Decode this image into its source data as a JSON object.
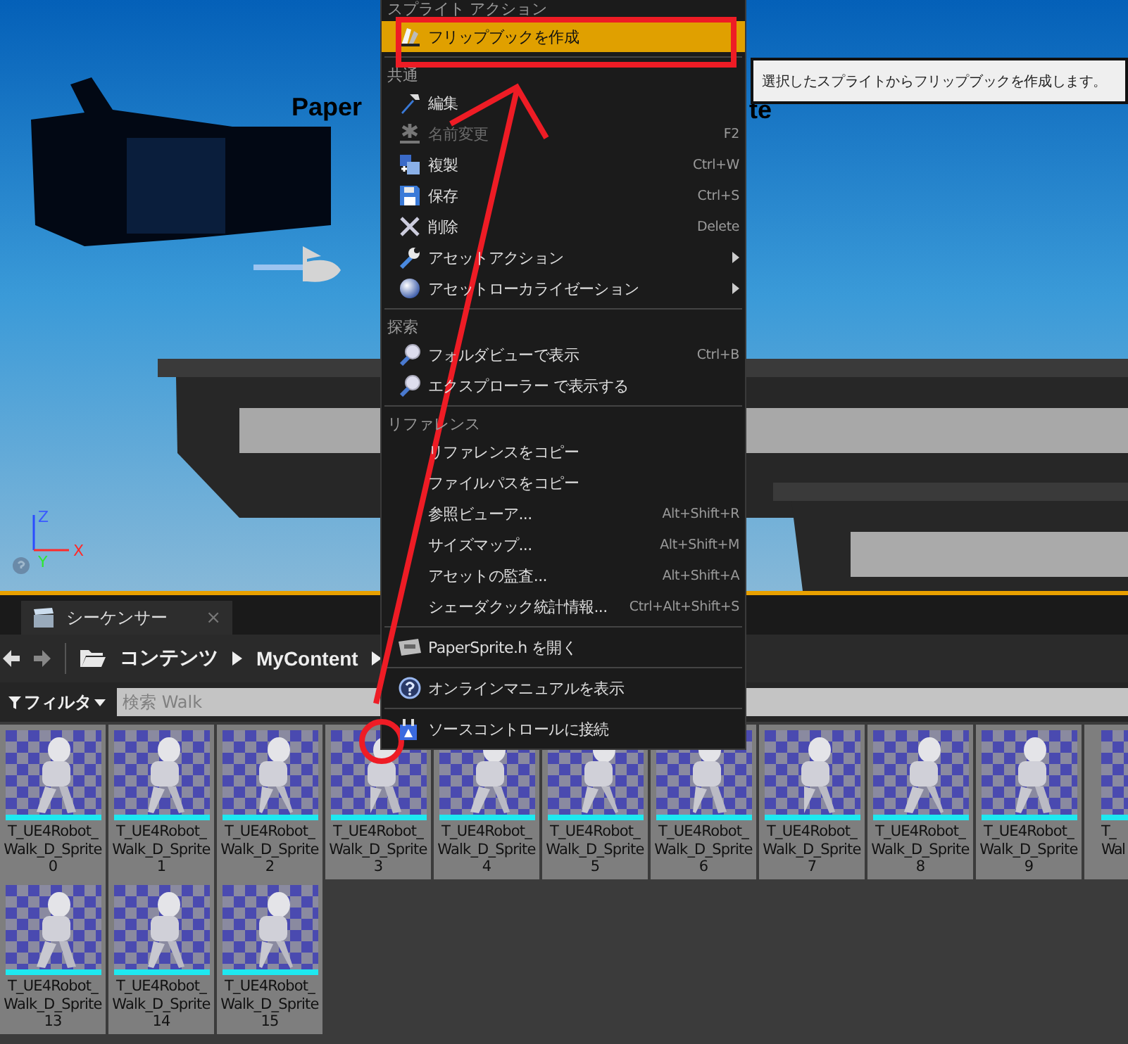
{
  "viewport": {
    "kind": "picture",
    "scene_text": [
      "Paper",
      "te"
    ],
    "axes": [
      "Z",
      "Y",
      "X"
    ]
  },
  "tabs": [
    {
      "label": "シーケンサー",
      "selected": true,
      "close": "×"
    }
  ],
  "breadcrumb": [
    "コンテンツ",
    "MyContent"
  ],
  "filter": {
    "label": "フィルタ"
  },
  "search": {
    "placeholder": "検索 Walk"
  },
  "menu": {
    "sections": [
      {
        "heading": "スプライト アクション",
        "items": [
          {
            "label": "フリップブックを作成",
            "kind": "flipbook",
            "selected": true,
            "disabled": false,
            "submenu": false
          }
        ]
      },
      {
        "heading": "共通",
        "items": [
          {
            "label": "編集",
            "kind": "hammer",
            "selected": false,
            "disabled": false,
            "submenu": false
          },
          {
            "label": "名前変更",
            "shortcut": "F2",
            "kind": "star",
            "selected": false,
            "disabled": true,
            "submenu": false
          },
          {
            "label": "複製",
            "shortcut": "Ctrl+W",
            "kind": "duplicate",
            "selected": false,
            "disabled": false,
            "submenu": false
          },
          {
            "label": "保存",
            "shortcut": "Ctrl+S",
            "kind": "floppy",
            "selected": false,
            "disabled": false,
            "submenu": false
          },
          {
            "label": "削除",
            "shortcut": "Delete",
            "kind": "cross",
            "selected": false,
            "disabled": false,
            "submenu": false
          },
          {
            "label": "アセットアクション",
            "kind": "wrench",
            "selected": false,
            "disabled": false,
            "submenu": true
          },
          {
            "label": "アセットローカライゼーション",
            "kind": "sphere",
            "selected": false,
            "disabled": false,
            "submenu": true
          }
        ]
      },
      {
        "heading": "探索",
        "items": [
          {
            "label": "フォルダビューで表示",
            "shortcut": "Ctrl+B",
            "kind": "magnifier",
            "selected": false,
            "disabled": false,
            "submenu": false
          },
          {
            "label": "エクスプローラー で表示する",
            "kind": "magnifier",
            "selected": false,
            "disabled": false,
            "submenu": false
          }
        ]
      },
      {
        "heading": "リファレンス",
        "items": [
          {
            "label": "リファレンスをコピー",
            "kind": "plain",
            "selected": false,
            "disabled": false,
            "submenu": false
          },
          {
            "label": "ファイルパスをコピー",
            "kind": "plain",
            "selected": false,
            "disabled": false,
            "submenu": false
          },
          {
            "label": "参照ビューア...",
            "shortcut": "Alt+Shift+R",
            "kind": "plain",
            "selected": false,
            "disabled": false,
            "submenu": false
          },
          {
            "label": "サイズマップ...",
            "shortcut": "Alt+Shift+M",
            "kind": "plain",
            "selected": false,
            "disabled": false,
            "submenu": false
          },
          {
            "label": "アセットの監査...",
            "shortcut": "Alt+Shift+A",
            "kind": "plain",
            "selected": false,
            "disabled": false,
            "submenu": false
          },
          {
            "label": "シェーダクック統計情報...",
            "shortcut": "Ctrl+Alt+Shift+S",
            "kind": "plain",
            "selected": false,
            "disabled": false,
            "submenu": false
          }
        ]
      },
      {
        "items": [
          {
            "label": "PaperSprite.h を開く",
            "kind": "code",
            "selected": false,
            "disabled": false,
            "submenu": false
          }
        ]
      },
      {
        "items": [
          {
            "label": "オンラインマニュアルを表示",
            "kind": "help",
            "selected": false,
            "disabled": false,
            "submenu": false
          }
        ]
      },
      {
        "items": [
          {
            "label": "ソースコントロールに接続",
            "kind": "plug",
            "selected": false,
            "disabled": false,
            "submenu": false
          }
        ]
      }
    ]
  },
  "tooltip": "選択したスプライトからフリップブックを作成します。",
  "assets": {
    "rows": [
      [
        {
          "lines": [
            "T_UE4Robot_",
            "Walk_D_Sprite",
            "0"
          ]
        },
        {
          "lines": [
            "T_UE4Robot_",
            "Walk_D_Sprite",
            "1"
          ]
        },
        {
          "lines": [
            "T_UE4Robot_",
            "Walk_D_Sprite",
            "2"
          ]
        },
        {
          "lines": [
            "T_UE4Robot_",
            "Walk_D_Sprite",
            "3"
          ]
        },
        {
          "lines": [
            "T_UE4Robot_",
            "Walk_D_Sprite",
            "4"
          ]
        },
        {
          "lines": [
            "T_UE4Robot_",
            "Walk_D_Sprite",
            "5"
          ]
        },
        {
          "lines": [
            "T_UE4Robot_",
            "Walk_D_Sprite",
            "6"
          ]
        },
        {
          "lines": [
            "T_UE4Robot_",
            "Walk_D_Sprite",
            "7"
          ]
        },
        {
          "lines": [
            "T_UE4Robot_",
            "Walk_D_Sprite",
            "8"
          ]
        },
        {
          "lines": [
            "T_UE4Robot_",
            "Walk_D_Sprite",
            "9"
          ]
        },
        {
          "lines": [
            "T_",
            "Wal"
          ],
          "partial": true
        }
      ],
      [
        {
          "lines": [
            "T_UE4Robot_",
            "Walk_D_Sprite",
            "13"
          ]
        },
        {
          "lines": [
            "T_UE4Robot_",
            "Walk_D_Sprite",
            "14"
          ]
        },
        {
          "lines": [
            "T_UE4Robot_",
            "Walk_D_Sprite",
            "15"
          ]
        }
      ]
    ]
  }
}
